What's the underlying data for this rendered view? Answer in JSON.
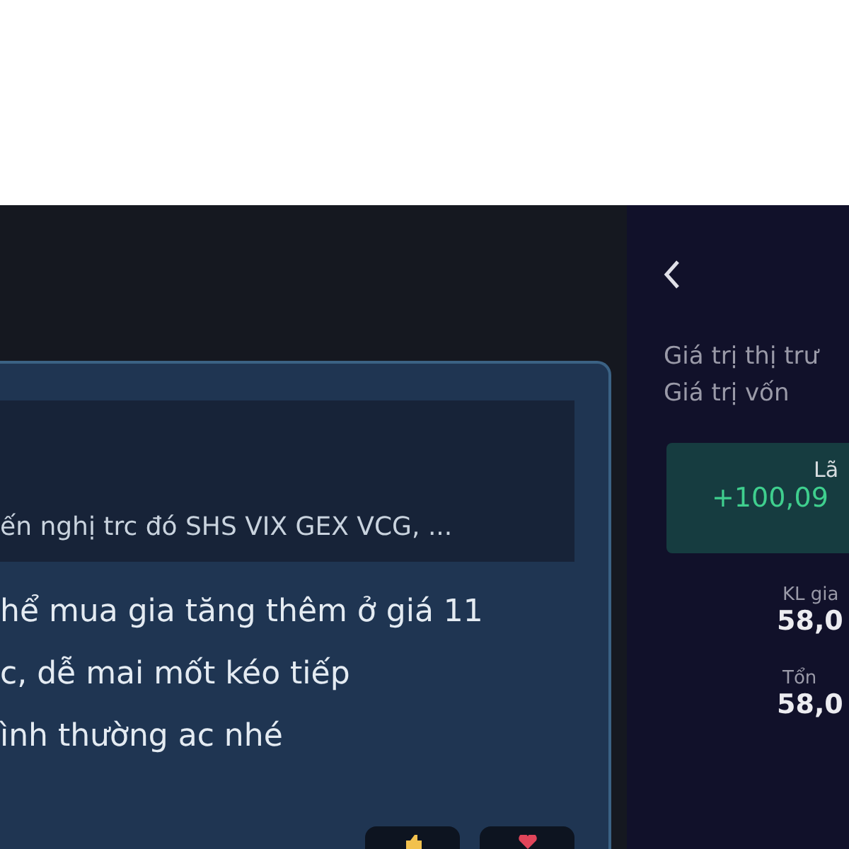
{
  "message": {
    "quote": "ến nghị trc đó SHS VIX GEX VCG, ...",
    "lines": [
      "hể mua gia tăng thêm ở giá 11",
      "c, dễ mai mốt kéo tiếp",
      "ình thường ac nhé"
    ],
    "reactions": [
      {
        "kind": "like"
      },
      {
        "kind": "heart"
      }
    ]
  },
  "detail": {
    "labels": [
      "Giá trị thị trư",
      "Giá trị vốn"
    ],
    "profit": {
      "label": "Lã",
      "value": "+100,09"
    },
    "stats": [
      {
        "label": "KL gia",
        "value": "58,0"
      },
      {
        "label": "Tổn",
        "value": "58,0"
      }
    ]
  }
}
